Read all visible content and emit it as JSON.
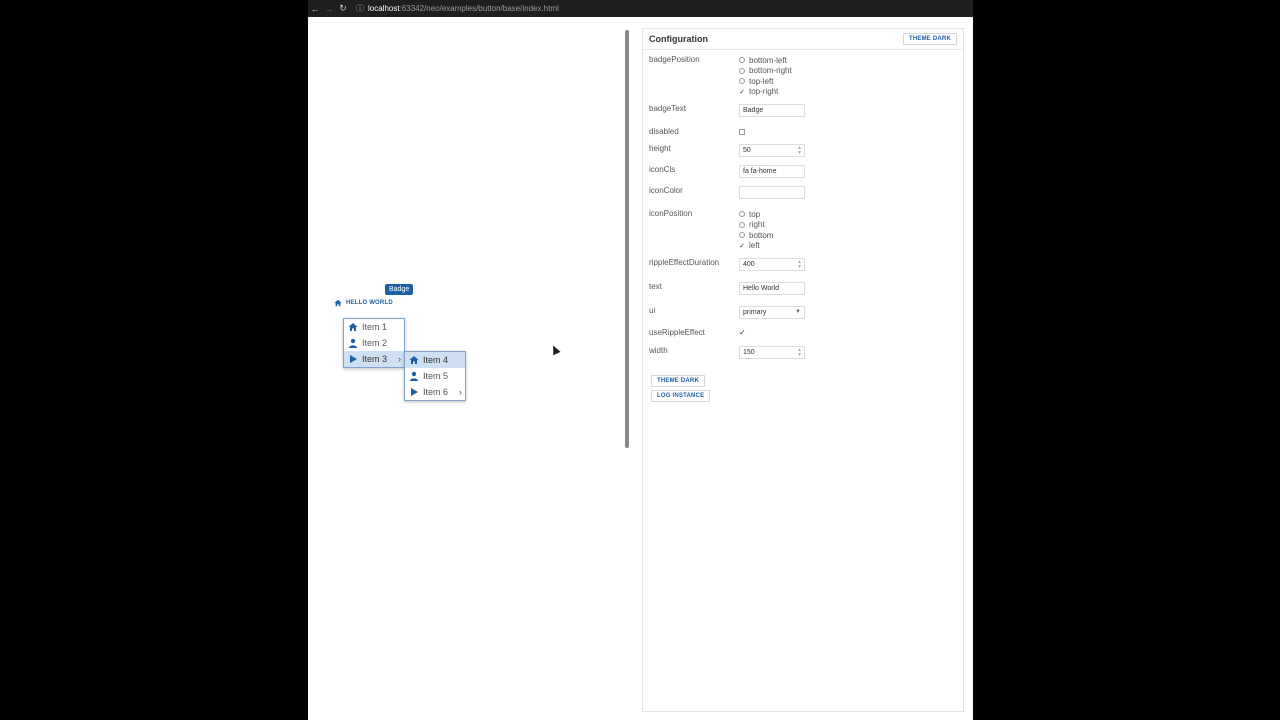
{
  "browser": {
    "back_icon": "back-arrow-icon",
    "forward_icon": "forward-arrow-icon",
    "reload_icon": "reload-icon",
    "url_host": "localhost",
    "url_path": ":63342/neo/examples/button/base/index.html"
  },
  "preview": {
    "button_text": "HELLO WORLD",
    "badge_text": "Badge",
    "menu1": [
      {
        "label": "Item 1",
        "icon": "home-icon"
      },
      {
        "label": "Item 2",
        "icon": "user-icon"
      },
      {
        "label": "Item 3",
        "icon": "play-icon",
        "has_submenu": true
      }
    ],
    "menu2": [
      {
        "label": "Item 4",
        "icon": "home-icon"
      },
      {
        "label": "Item 5",
        "icon": "user-icon"
      },
      {
        "label": "Item 6",
        "icon": "play-icon",
        "has_submenu": true
      }
    ]
  },
  "config": {
    "title": "Configuration",
    "theme_dark_top": "THEME DARK",
    "badgePosition": {
      "label": "badgePosition",
      "options": [
        "bottom-left",
        "bottom-right",
        "top-left",
        "top-right"
      ],
      "selected": "top-right"
    },
    "badgeText": {
      "label": "badgeText",
      "value": "Badge"
    },
    "disabled": {
      "label": "disabled",
      "checked": false
    },
    "height": {
      "label": "height",
      "value": "50"
    },
    "iconCls": {
      "label": "iconCls",
      "value": "fa fa-home"
    },
    "iconColor": {
      "label": "iconColor",
      "value": ""
    },
    "iconPosition": {
      "label": "iconPosition",
      "options": [
        "top",
        "right",
        "bottom",
        "left"
      ],
      "selected": "left"
    },
    "rippleEffectDuration": {
      "label": "rippleEffectDuration",
      "value": "400"
    },
    "text": {
      "label": "text",
      "value": "Hello World"
    },
    "ui": {
      "label": "ui",
      "value": "primary"
    },
    "useRippleEffect": {
      "label": "useRippleEffect",
      "checked": true
    },
    "width": {
      "label": "width",
      "value": "150"
    },
    "theme_dark_bottom": "THEME DARK",
    "log_instance": "LOG INSTANCE"
  },
  "colors": {
    "accent": "#1c60a6",
    "menu_active": "#cfe0f3"
  }
}
